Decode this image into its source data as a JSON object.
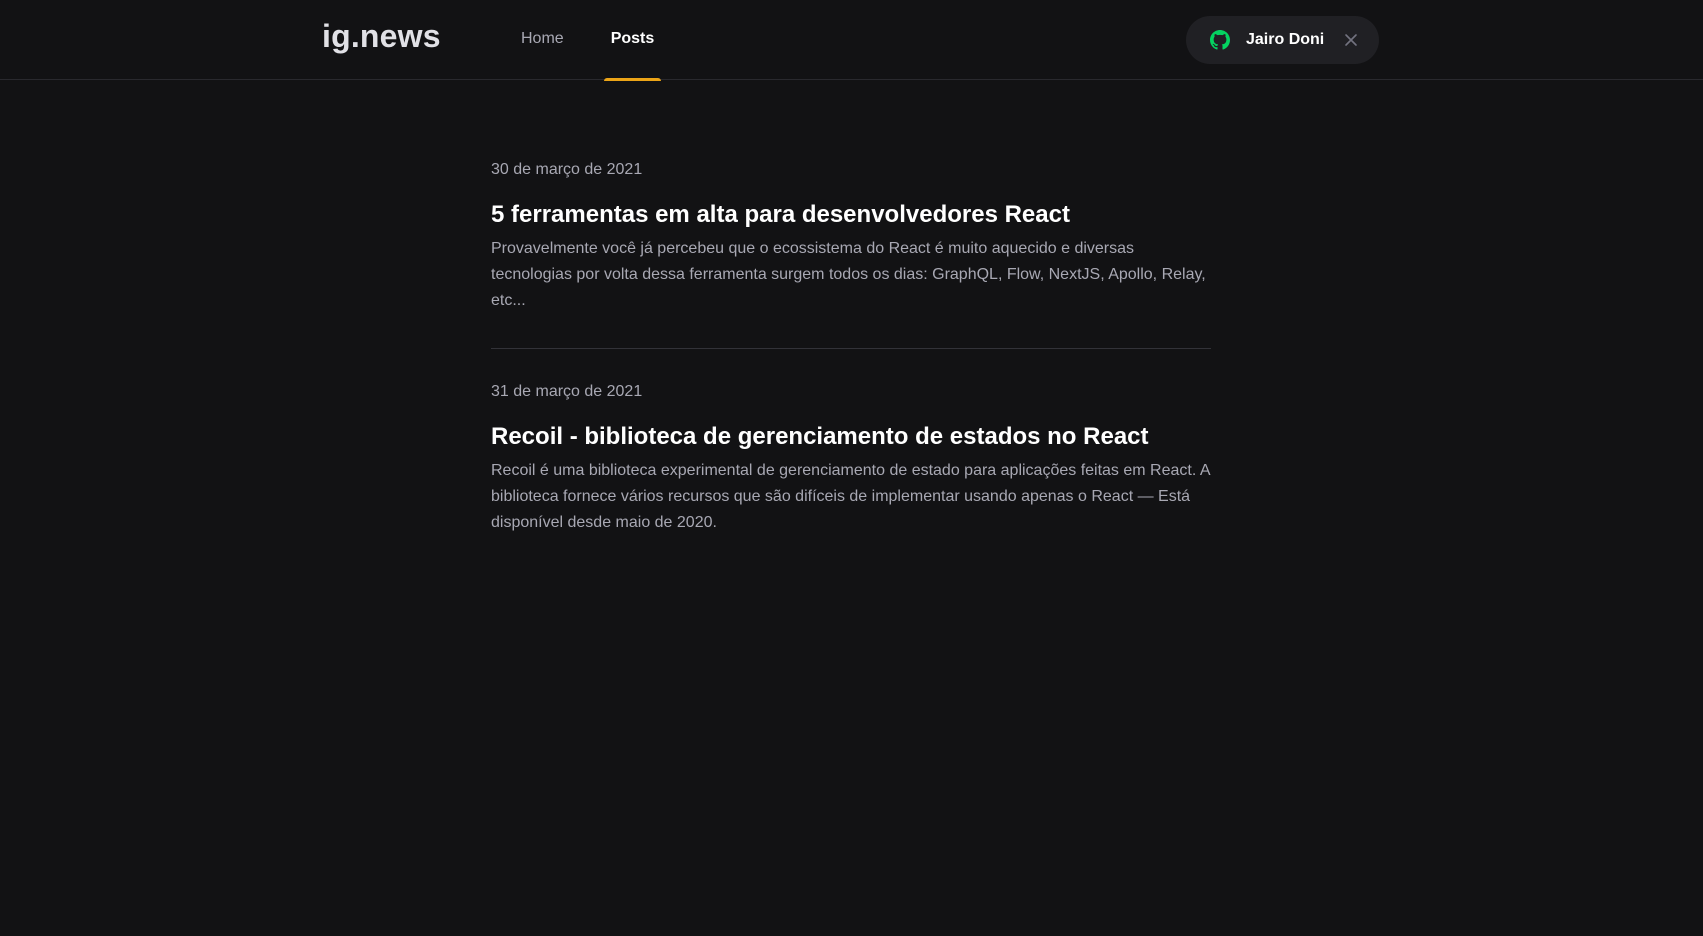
{
  "header": {
    "logo": "ig.news",
    "nav": [
      {
        "label": "Home",
        "active": false
      },
      {
        "label": "Posts",
        "active": true
      }
    ],
    "accent_color": "#eba417",
    "user": {
      "name": "Jairo Doni",
      "provider_icon": "github-icon",
      "provider_icon_color": "#04d361",
      "close_icon": "close-icon"
    }
  },
  "posts": [
    {
      "date": "30 de março de 2021",
      "title": "5 ferramentas em alta para desenvolvedores React",
      "excerpt": "Provavelmente você já percebeu que o ecossistema do React é muito aquecido e diversas tecnologias por volta dessa ferramenta surgem todos os dias: GraphQL, Flow, NextJS, Apollo, Relay, etc..."
    },
    {
      "date": "31 de março de 2021",
      "title": "Recoil - biblioteca de gerenciamento de estados no React",
      "excerpt": "Recoil é uma biblioteca experimental de gerenciamento de estado para aplicações feitas em React. A biblioteca fornece vários recursos que são difíceis de implementar usando apenas o React — Está disponível desde maio de 2020."
    }
  ]
}
